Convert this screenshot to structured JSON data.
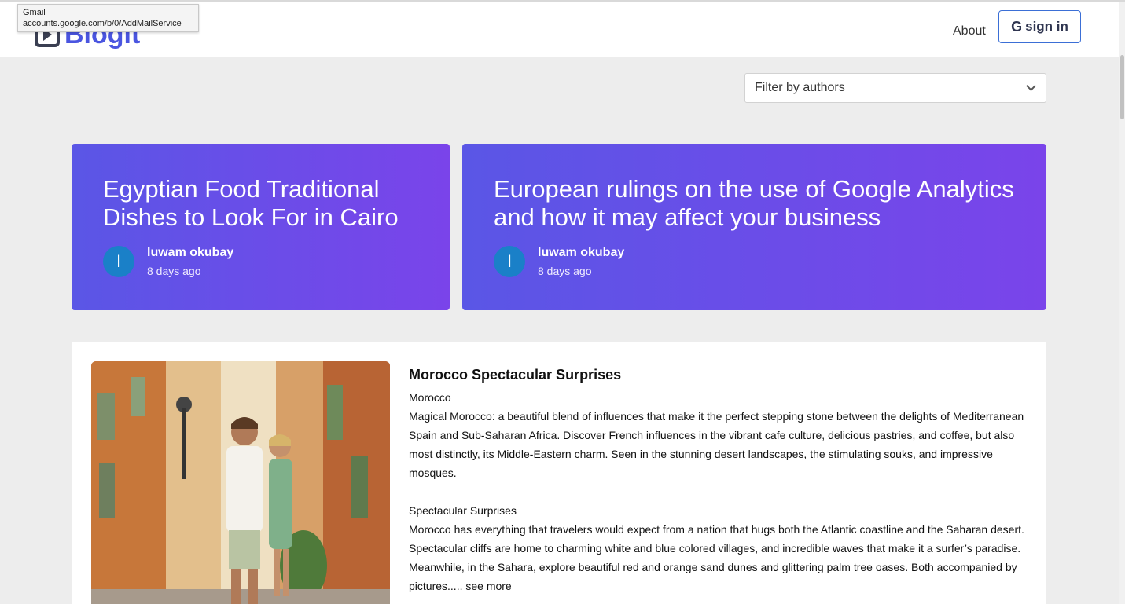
{
  "tooltip": {
    "line1": "Gmail",
    "line2": "accounts.google.com/b/0/AddMailService"
  },
  "header": {
    "logo": "Blogit",
    "about": "About",
    "signin": "sign in",
    "signin_icon": "G"
  },
  "filter": {
    "placeholder": "Filter by authors"
  },
  "featured": [
    {
      "title": "Egyptian Food Traditional Dishes to Look For in Cairo",
      "avatar": "I",
      "author": "luwam okubay",
      "time": "8 days ago"
    },
    {
      "title": "European rulings on the use of Google Analytics and how it may affect your business",
      "avatar": "I",
      "author": "luwam okubay",
      "time": "8 days ago"
    }
  ],
  "post": {
    "title": "Morocco Spectacular Surprises",
    "subtitle": "Morocco",
    "para1": "Magical Morocco: a beautiful blend of influences that make it the perfect stepping stone between the delights of Mediterranean Spain and Sub-Saharan Africa. Discover French influences in the vibrant cafe culture, delicious pastries, and coffee, but also most distinctly, its Middle-Eastern charm. Seen in the stunning desert landscapes, the stimulating souks, and impressive mosques.",
    "subheading2": "Spectacular Surprises",
    "para2": "Morocco has everything that travelers would expect from a nation that hugs both the Atlantic coastline and the Saharan desert. Spectacular cliffs are home to charming white and blue colored villages, and incredible waves that make it a surfer’s paradise. Meanwhile, in the Sahara, explore beautiful red and orange sand dunes and glittering palm tree oases. Both accompanied by pictures..... see more"
  }
}
